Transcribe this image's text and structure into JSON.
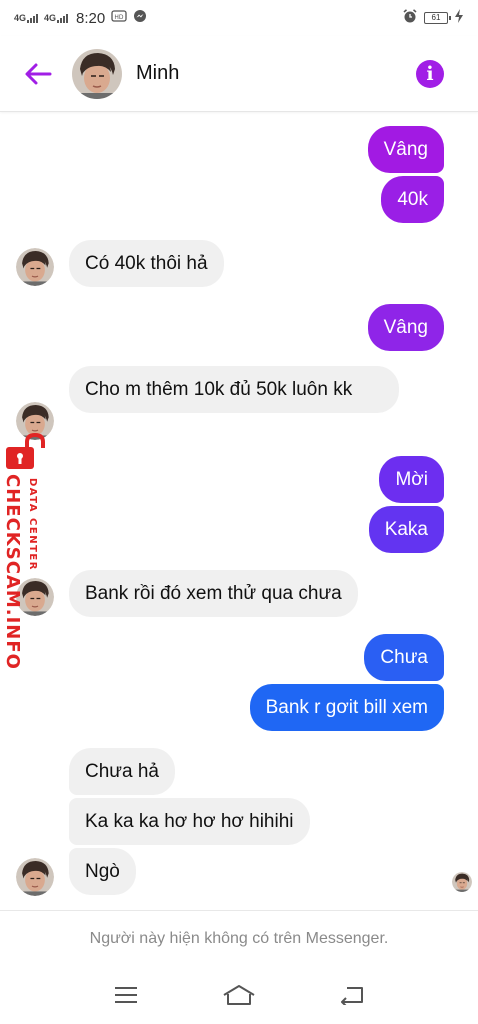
{
  "status_bar": {
    "network_1": "4G",
    "network_2": "4G",
    "time": "8:20",
    "battery": "61",
    "icons": [
      "alarm-icon",
      "charging-icon",
      "messenger-icon",
      "hd-icon"
    ]
  },
  "header": {
    "contact_name": "Minh",
    "icons": [
      "back-arrow-icon",
      "info-icon"
    ]
  },
  "watermark": {
    "brand": "CHECKSCAM.INFO",
    "tagline": "DATA CENTER"
  },
  "messages": [
    {
      "sender": "me",
      "text": "Vâng"
    },
    {
      "sender": "me",
      "text": "40k"
    },
    {
      "sender": "Minh",
      "text": "Có 40k thôi hả"
    },
    {
      "sender": "me",
      "text": "Vâng"
    },
    {
      "sender": "Minh",
      "text": "Cho m thêm 10k đủ 50k luôn kk"
    },
    {
      "sender": "me",
      "text": "Mời"
    },
    {
      "sender": "me",
      "text": "Kaka"
    },
    {
      "sender": "Minh",
      "text": "Bank rồi đó xem thử qua chưa"
    },
    {
      "sender": "me",
      "text": "Chưa"
    },
    {
      "sender": "me",
      "text": "Bank r gơit bill xem"
    },
    {
      "sender": "Minh",
      "text": "Chưa hả"
    },
    {
      "sender": "Minh",
      "text": "Ka ka ka hơ hơ hơ hihihi"
    },
    {
      "sender": "Minh",
      "text": "Ngò"
    }
  ],
  "footer": {
    "note": "Người này hiện không có trên Messenger."
  },
  "nav_icons": [
    "menu-icon",
    "home-icon",
    "back-icon"
  ],
  "colors": {
    "accent_purple": "#a11ee6",
    "bubble_incoming": "#f0f0f0",
    "watermark_red": "#e02424"
  }
}
